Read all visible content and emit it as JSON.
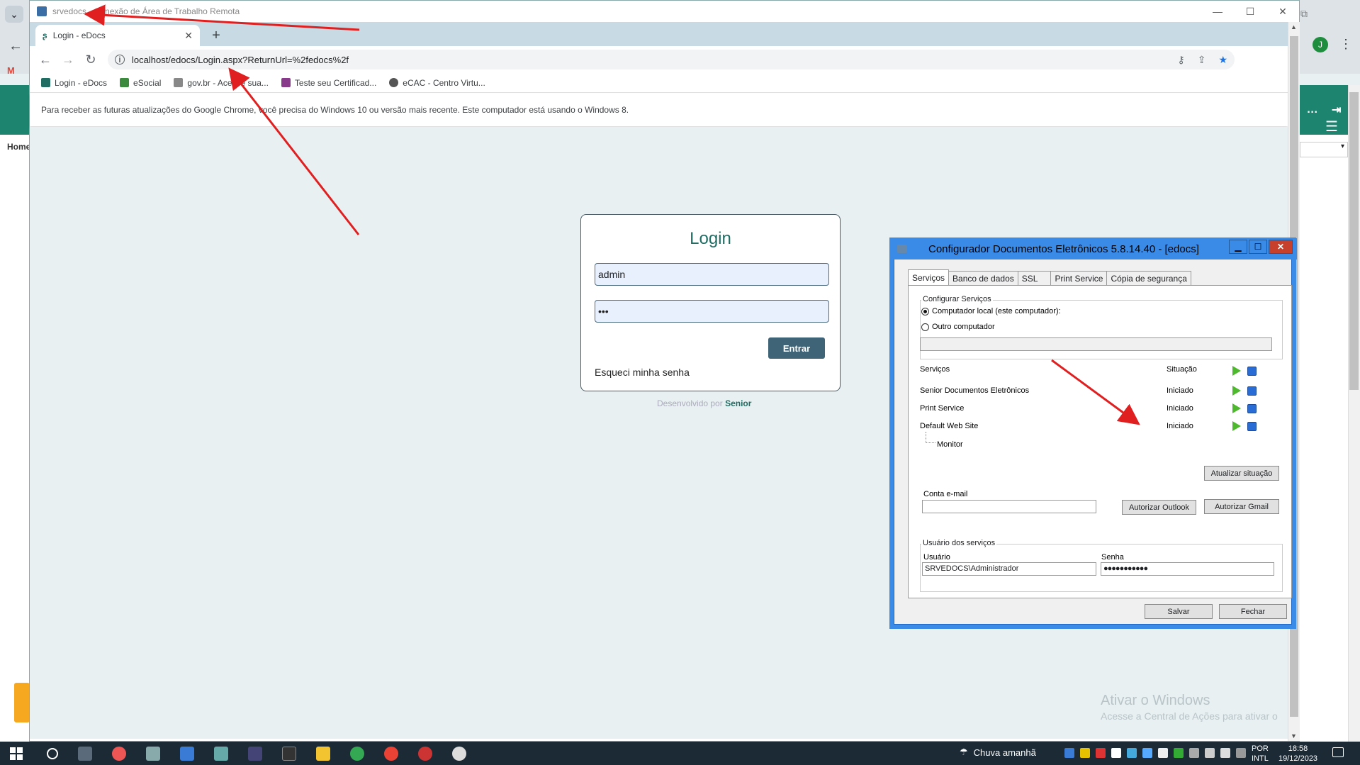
{
  "remote_window": {
    "title": "srvedocs - Conexão de Área de Trabalho Remota"
  },
  "browser": {
    "tab_title": "Login - eDocs",
    "url": "localhost/edocs/Login.aspx?ReturnUrl=%2fedocs%2f",
    "bookmarks": [
      {
        "label": "Login - eDocs",
        "color": "#1f6d63"
      },
      {
        "label": "eSocial",
        "color": "#3b8a3e"
      },
      {
        "label": "gov.br - Acesse sua...",
        "color": "#888888"
      },
      {
        "label": "Teste seu Certificad...",
        "color": "#8a3a8a"
      },
      {
        "label": "eCAC - Centro Virtu...",
        "color": "#555555"
      }
    ],
    "infobar": "Para receber as futuras atualizações do Google Chrome, você precisa do Windows 10 ou versão mais recente. Este computador está usando o Windows 8."
  },
  "login": {
    "title": "Login",
    "username": "admin",
    "password": "•••",
    "submit": "Entrar",
    "forgot": "Esqueci minha senha",
    "developed_by": "Desenvolvido por",
    "brand": "Senior"
  },
  "config": {
    "title": "Configurador Documentos Eletrônicos 5.8.14.40 - [edocs]",
    "tabs": [
      "Serviços",
      "Banco de dados",
      "SSL",
      "Print Service",
      "Cópia de segurança"
    ],
    "group_config": "Configurar Serviços",
    "radio_local": "Computador local (este computador):",
    "radio_other": "Outro computador",
    "col_services": "Serviços",
    "col_status": "Situação",
    "services": [
      {
        "name": "Senior Documentos Eletrônicos",
        "status": "Iniciado"
      },
      {
        "name": "Print Service",
        "status": "Iniciado"
      },
      {
        "name": "Default Web Site",
        "status": "Iniciado"
      }
    ],
    "monitor": "Monitor",
    "refresh_btn": "Atualizar situação",
    "email_label": "Conta e-mail",
    "auth_outlook": "Autorizar Outlook",
    "auth_gmail": "Autorizar Gmail",
    "group_users": "Usuário dos serviços",
    "user_label": "Usuário",
    "user_value": "SRVEDOCS\\Administrador",
    "pass_label": "Senha",
    "pass_value": "●●●●●●●●●●●",
    "save": "Salvar",
    "close": "Fechar"
  },
  "watermark": {
    "line1": "Ativar o Windows",
    "line2": "Acesse a Central de Ações para ativar o"
  },
  "host": {
    "home": "Home",
    "avatar": "J"
  },
  "taskbar": {
    "weather": "Chuva amanhã",
    "lang1": "POR",
    "lang2": "INTL",
    "time": "18:58",
    "date": "19/12/2023"
  }
}
